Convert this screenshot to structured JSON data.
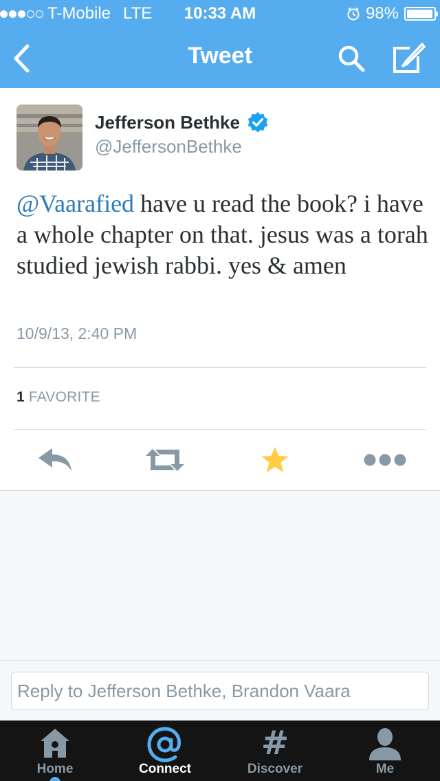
{
  "status_bar": {
    "carrier": "T-Mobile",
    "network": "LTE",
    "time": "10:33 AM",
    "battery_text": "98%",
    "battery_level": 0.98,
    "signal_bars_filled": 3,
    "signal_bars_total": 5
  },
  "nav": {
    "title": "Tweet",
    "back_icon": "chevron-left-icon",
    "search_icon": "search-icon",
    "compose_icon": "compose-icon",
    "accent_color": "#55acee"
  },
  "tweet": {
    "author_name": "Jefferson Bethke",
    "author_handle": "@JeffersonBethke",
    "verified": true,
    "mention": "@Vaarafied",
    "body": " have u read the book? i have a whole chapter on that. jesus was a torah studied jewish rabbi. yes & amen",
    "timestamp": "10/9/13, 2:40 PM",
    "favorite_count": "1",
    "favorite_label": "FAVORITE",
    "mention_color": "#2b7bb9"
  },
  "actions": [
    {
      "name": "reply",
      "icon": "reply-icon"
    },
    {
      "name": "retweet",
      "icon": "retweet-icon"
    },
    {
      "name": "favorite",
      "icon": "star-icon",
      "active_color": "#ffcc44"
    },
    {
      "name": "more",
      "icon": "more-icon"
    }
  ],
  "reply": {
    "placeholder": "Reply to Jefferson Bethke, Brandon Vaara"
  },
  "tabs": [
    {
      "label": "Home",
      "icon": "home-icon",
      "active": false
    },
    {
      "label": "Connect",
      "icon": "at-icon",
      "active": true
    },
    {
      "label": "Discover",
      "icon": "hash-icon",
      "active": false
    },
    {
      "label": "Me",
      "icon": "person-icon",
      "active": false
    }
  ]
}
